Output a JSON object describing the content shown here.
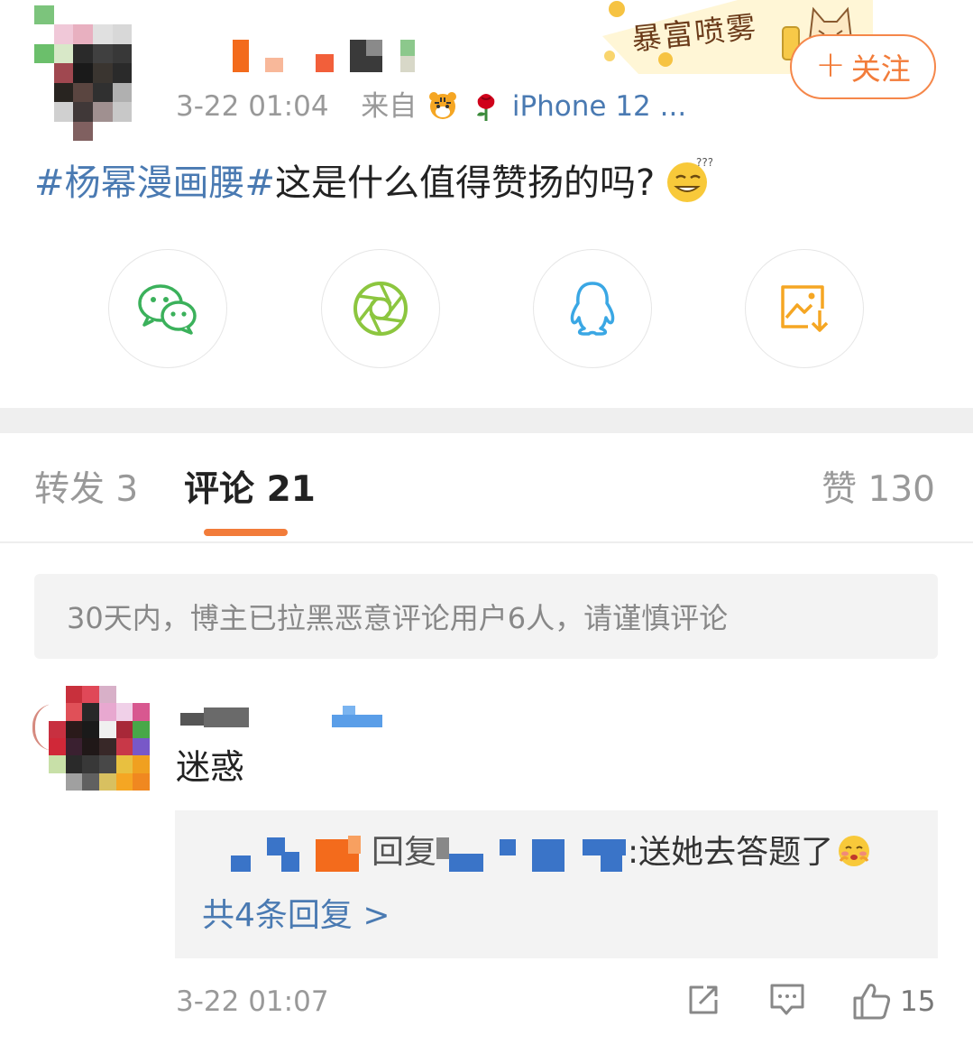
{
  "post": {
    "time": "3-22 01:04",
    "source_prefix": "来自",
    "source_emoji_1": "tiger-emoji",
    "source_emoji_2": "rose-emoji",
    "source_device": "iPhone 12 ...",
    "follow_plus": "+",
    "follow_label": "关注",
    "banner_text": "暴富喷雾",
    "topic": "#杨幂漫画腰#",
    "text": "这是什么值得赞扬的吗?",
    "emoji": "smirk-question-emoji"
  },
  "share": {
    "items": [
      {
        "name": "wechat",
        "icon": "wechat-icon",
        "color": "#3bb15b"
      },
      {
        "name": "moments",
        "icon": "moments-aperture-icon",
        "color": "#8cc63f"
      },
      {
        "name": "qq",
        "icon": "qq-penguin-icon",
        "color": "#3aa7e4"
      },
      {
        "name": "save-image",
        "icon": "save-image-icon",
        "color": "#f5a623"
      }
    ]
  },
  "tabs": {
    "repost": "转发 3",
    "comment": "评论 21",
    "like": "赞 130"
  },
  "notice": "30天内，博主已拉黑恶意评论用户6人，请谨慎评论",
  "comment": {
    "text": "迷惑",
    "reply_word": "回复",
    "reply_body": ":送她去答题了",
    "reply_emoji": "shy-emoji",
    "more_replies": "共4条回复 >",
    "time": "3-22 01:07",
    "like_count": "15"
  },
  "colors": {
    "accent": "#f27c3a",
    "link": "#4a7ab2"
  }
}
